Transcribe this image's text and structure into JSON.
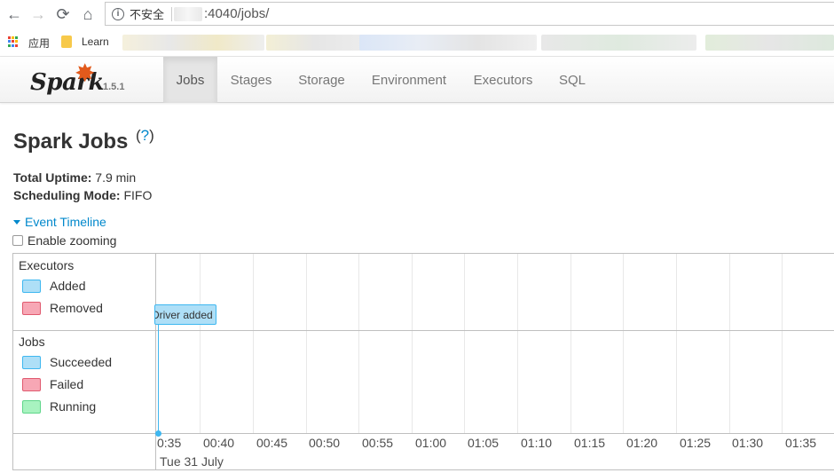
{
  "browser": {
    "nav": {
      "back": "←",
      "forward": "→",
      "reload": "⟳",
      "home": "⌂"
    },
    "security_label": "不安全",
    "url": ":4040/jobs/",
    "bookmarks": {
      "apps": "应用",
      "learn": "Learn"
    }
  },
  "spark": {
    "brand": "Spark",
    "version": "1.5.1",
    "tabs": [
      {
        "label": "Jobs",
        "active": true
      },
      {
        "label": "Stages"
      },
      {
        "label": "Storage"
      },
      {
        "label": "Environment"
      },
      {
        "label": "Executors"
      },
      {
        "label": "SQL"
      }
    ]
  },
  "page": {
    "title": "Spark Jobs",
    "help": "?",
    "uptime_label": "Total Uptime:",
    "uptime_value": "7.9 min",
    "mode_label": "Scheduling Mode:",
    "mode_value": "FIFO",
    "timeline_toggle": "Event Timeline",
    "zoom_label": "Enable zooming"
  },
  "timeline": {
    "executors_title": "Executors",
    "executors_legend": [
      {
        "label": "Added",
        "color": "#aedff7",
        "border": "#3eb7f0"
      },
      {
        "label": "Removed",
        "color": "#f7a7b5",
        "border": "#e05a6f"
      }
    ],
    "jobs_title": "Jobs",
    "jobs_legend": [
      {
        "label": "Succeeded",
        "color": "#aedff7",
        "border": "#3eb7f0"
      },
      {
        "label": "Failed",
        "color": "#f7a7b5",
        "border": "#e05a6f"
      },
      {
        "label": "Running",
        "color": "#a8f3c0",
        "border": "#5fd68a"
      }
    ],
    "event_label": "Driver added",
    "ticks": [
      "0:35",
      "00:40",
      "00:45",
      "00:50",
      "00:55",
      "01:00",
      "01:05",
      "01:10",
      "01:15",
      "01:20",
      "01:25",
      "01:30",
      "01:35"
    ],
    "date_label": "Tue 31 July"
  }
}
